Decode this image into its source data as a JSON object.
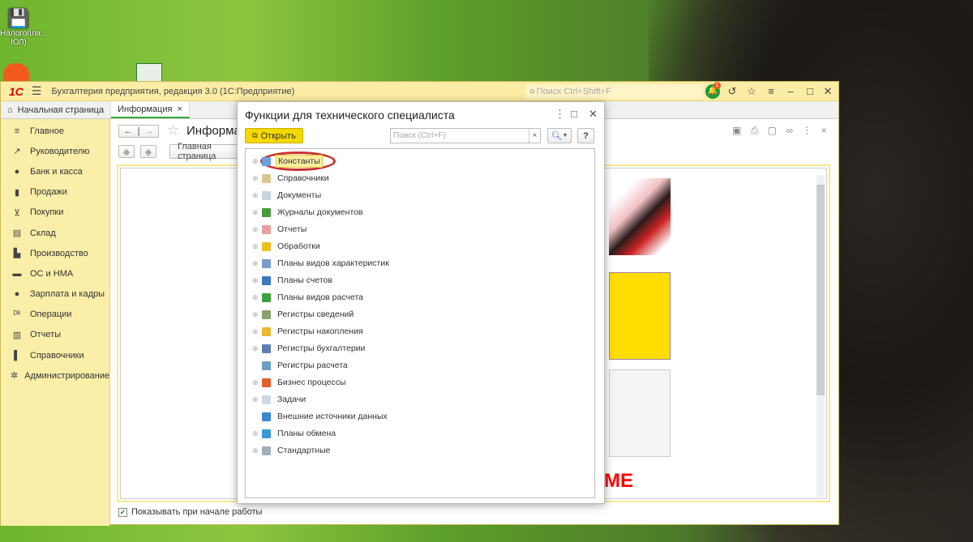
{
  "desktop": {
    "icons": [
      {
        "label": "Налогопла... ЮЛ)",
        "icon": "floppy-shortcut-icon"
      },
      {
        "label": "",
        "icon": "1c-cloud-icon"
      },
      {
        "label": "",
        "icon": "excel-icon"
      }
    ]
  },
  "app": {
    "title": "Бухгалтерия предприятия, редакция 3.0  (1С:Предприятие)",
    "logo": "1С",
    "search_placeholder": "Поиск Ctrl+Shift+F",
    "notifications": "1"
  },
  "tabs": [
    {
      "label": "Начальная страница"
    },
    {
      "label": "Информация",
      "active": true
    }
  ],
  "sidebar": {
    "items": [
      {
        "label": "Главное",
        "icon": "menu-icon"
      },
      {
        "label": "Руководителю",
        "icon": "trend-icon"
      },
      {
        "label": "Банк и касса",
        "icon": "coin-icon"
      },
      {
        "label": "Продажи",
        "icon": "bag-icon"
      },
      {
        "label": "Покупки",
        "icon": "cart-icon"
      },
      {
        "label": "Склад",
        "icon": "box-icon"
      },
      {
        "label": "Производство",
        "icon": "factory-icon"
      },
      {
        "label": "ОС и НМА",
        "icon": "truck-icon"
      },
      {
        "label": "Зарплата и кадры",
        "icon": "person-icon"
      },
      {
        "label": "Операции",
        "icon": "dt-kt-icon"
      },
      {
        "label": "Отчеты",
        "icon": "chart-icon"
      },
      {
        "label": "Справочники",
        "icon": "book-icon"
      },
      {
        "label": "Администрирование",
        "icon": "gear-icon"
      }
    ]
  },
  "content": {
    "title": "Информация",
    "home_button": "Главная страница",
    "banner_text": "МЕ",
    "show_on_start": "Показывать при начале работы",
    "show_on_start_checked": true
  },
  "dialog": {
    "title": "Функции для технического специалиста",
    "open_button": "Открыть",
    "search_placeholder": "Поиск (Ctrl+F)",
    "help": "?",
    "items": [
      {
        "label": "Константы",
        "expandable": true,
        "color": "#6a9fd8",
        "selected": true
      },
      {
        "label": "Справочники",
        "expandable": true,
        "color": "#d8c890"
      },
      {
        "label": "Документы",
        "expandable": true,
        "color": "#c8d4e4"
      },
      {
        "label": "Журналы документов",
        "expandable": true,
        "color": "#4a9a3a"
      },
      {
        "label": "Отчеты",
        "expandable": true,
        "color": "#e8a0a0"
      },
      {
        "label": "Обработки",
        "expandable": true,
        "color": "#e8c020"
      },
      {
        "label": "Планы видов характеристик",
        "expandable": true,
        "color": "#7a9cc8"
      },
      {
        "label": "Планы счетов",
        "expandable": true,
        "color": "#3a78c0"
      },
      {
        "label": "Планы видов расчета",
        "expandable": true,
        "color": "#3aa040"
      },
      {
        "label": "Регистры сведений",
        "expandable": true,
        "color": "#8aa070"
      },
      {
        "label": "Регистры накопления",
        "expandable": true,
        "color": "#e8b830"
      },
      {
        "label": "Регистры бухгалтерии",
        "expandable": true,
        "color": "#5a80b0"
      },
      {
        "label": "Регистры расчета",
        "expandable": false,
        "color": "#6aa0c0"
      },
      {
        "label": "Бизнес процессы",
        "expandable": true,
        "color": "#e06030"
      },
      {
        "label": "Задачи",
        "expandable": true,
        "color": "#d0d8e4"
      },
      {
        "label": "Внешние источники данных",
        "expandable": false,
        "color": "#3a88d0"
      },
      {
        "label": "Планы обмена",
        "expandable": true,
        "color": "#3a9ad8"
      },
      {
        "label": "Стандартные",
        "expandable": true,
        "color": "#a0b0c0"
      }
    ]
  }
}
